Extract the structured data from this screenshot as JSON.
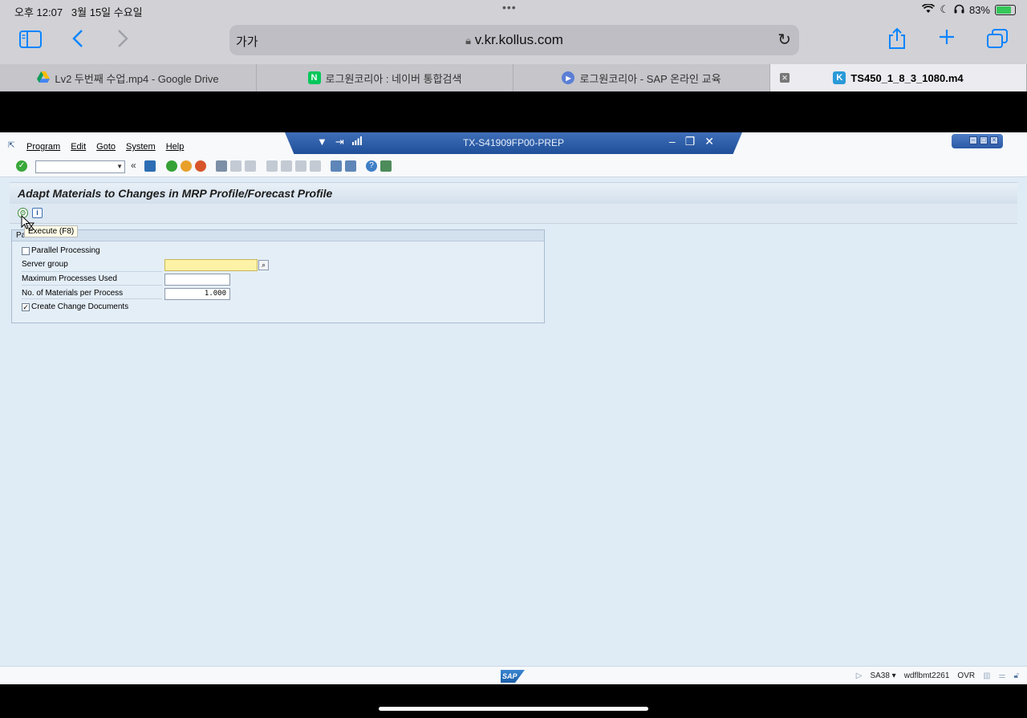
{
  "ios_status": {
    "time": "오후 12:07",
    "date": "3월 15일 수요일",
    "battery": "83%"
  },
  "browser": {
    "text_size_label": "가가",
    "url": "v.kr.kollus.com",
    "tabs": [
      {
        "title": "Lv2 두번째 수업.mp4 - Google Drive",
        "icon": "google-drive-icon"
      },
      {
        "title": "로그원코리아 : 네이버 통합검색",
        "icon": "naver-icon",
        "icon_text": "N"
      },
      {
        "title": "로그원코리아 - SAP 온라인 교육",
        "icon": "play-icon"
      },
      {
        "title": "TS450_1_8_3_1080.m4",
        "icon": "kollus-icon",
        "icon_text": "K"
      }
    ]
  },
  "sap": {
    "menu": [
      "Program",
      "Edit",
      "Goto",
      "System",
      "Help"
    ],
    "system_title": "TX-S41909FP00-PREP",
    "screen_title": "Adapt Materials to Changes in MRP Profile/Forecast Profile",
    "tooltip": "Execute   (F8)",
    "group_title": "Pa",
    "fields": {
      "parallel_processing": {
        "label": "Parallel Processing",
        "checked": false
      },
      "server_group": {
        "label": "Server group",
        "value": ""
      },
      "max_processes": {
        "label": "Maximum Processes Used",
        "value": ""
      },
      "materials_per_process": {
        "label": "No. of Materials per Process",
        "value": "1.000"
      },
      "create_change_docs": {
        "label": "Create Change Documents",
        "checked": true,
        "mark": "✓"
      }
    },
    "status": {
      "logo": "SAP",
      "transaction": "SA38",
      "server": "wdflbmt2261",
      "mode": "OVR"
    }
  }
}
